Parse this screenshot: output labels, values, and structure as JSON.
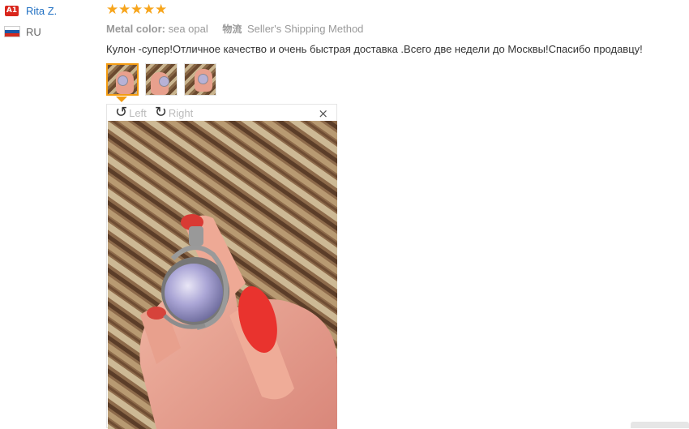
{
  "reviewer": {
    "level_badge": "A1",
    "name": "Rita Z.",
    "country_code": "RU",
    "flag_colors": [
      "#ffffff",
      "#1c57a5",
      "#d52b1e"
    ]
  },
  "review": {
    "rating": 5,
    "star_color": "#f7a51c",
    "metal_color_label": "Metal color:",
    "metal_color_value": "sea opal",
    "shipping_icon_text": "物流",
    "shipping_value": "Seller's Shipping Method",
    "text": "Кулон -супер!Отличное качество и очень быстрая доставка .Всего две недели до Москвы!Спасибо продавцу!"
  },
  "thumbnails": {
    "count": 3,
    "active_index": 0,
    "accent_color": "#f39c12"
  },
  "viewer": {
    "rotate_left_label": "Left",
    "rotate_right_label": "Right",
    "close_glyph": "×",
    "rotate_left_icon": "rotate-left-icon",
    "rotate_right_icon": "rotate-right-icon"
  }
}
